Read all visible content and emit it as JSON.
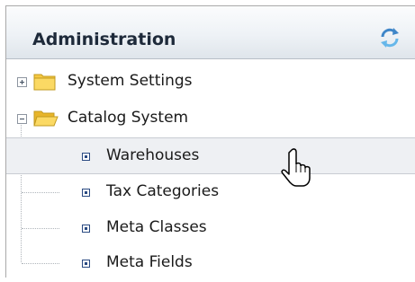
{
  "panel": {
    "title": "Administration",
    "refresh_icon": "refresh-icon"
  },
  "tree": {
    "nodes": [
      {
        "label": "System Settings",
        "expanded": false,
        "icon": "folder-closed-icon"
      },
      {
        "label": "Catalog System",
        "expanded": true,
        "icon": "folder-open-icon",
        "children": [
          {
            "label": "Warehouses",
            "selected": true,
            "icon": "leaf-node-icon"
          },
          {
            "label": "Tax Categories",
            "icon": "leaf-node-icon"
          },
          {
            "label": "Meta Classes",
            "icon": "leaf-node-icon"
          },
          {
            "label": "Meta Fields",
            "icon": "leaf-node-icon"
          }
        ]
      }
    ]
  },
  "colors": {
    "header_text": "#1e2a3a",
    "folder": "#f5c842",
    "selected_row": "#eef0f3",
    "leaf_icon": "#2a4a82"
  },
  "cursor": {
    "icon": "hand-pointer-icon"
  }
}
